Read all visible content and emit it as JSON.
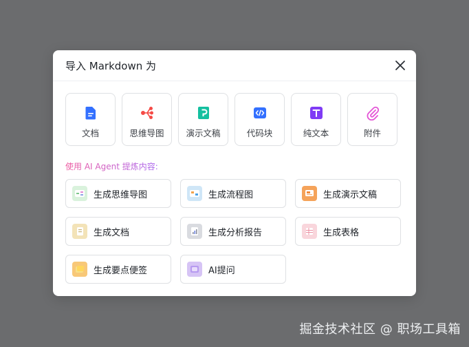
{
  "dialog": {
    "title": "导入 Markdown 为"
  },
  "formats": [
    {
      "label": "文档",
      "icon": "doc-icon",
      "color": "#3370ff"
    },
    {
      "label": "思维导图",
      "icon": "mindmap-icon",
      "color": "#f54a45"
    },
    {
      "label": "演示文稿",
      "icon": "slides-icon",
      "color": "#14c0a0"
    },
    {
      "label": "代码块",
      "icon": "code-icon",
      "color": "#3370ff"
    },
    {
      "label": "纯文本",
      "icon": "text-icon",
      "color": "#7f3bf5"
    },
    {
      "label": "附件",
      "icon": "attachment-icon",
      "color": "#e455d6"
    }
  ],
  "ai": {
    "label": "使用 AI Agent 提炼内容:",
    "buttons": [
      {
        "label": "生成思维导图",
        "icon": "mindmap-thumb-icon",
        "color": "#d9f2dc"
      },
      {
        "label": "生成流程图",
        "icon": "flowchart-thumb-icon",
        "color": "#cfe6f7"
      },
      {
        "label": "生成演示文稿",
        "icon": "slides-thumb-icon",
        "color": "#f5a35a"
      },
      {
        "label": "生成文档",
        "icon": "doc-thumb-icon",
        "color": "#f3e3b8"
      },
      {
        "label": "生成分析报告",
        "icon": "report-thumb-icon",
        "color": "#d9dbe0"
      },
      {
        "label": "生成表格",
        "icon": "table-thumb-icon",
        "color": "#f9d6dc"
      },
      {
        "label": "生成要点便签",
        "icon": "note-thumb-icon",
        "color": "#f8c878"
      },
      {
        "label": "AI提问",
        "icon": "ai-ask-thumb-icon",
        "color": "#d6c4f5"
      }
    ]
  },
  "watermark": "掘金技术社区 @ 职场工具箱"
}
